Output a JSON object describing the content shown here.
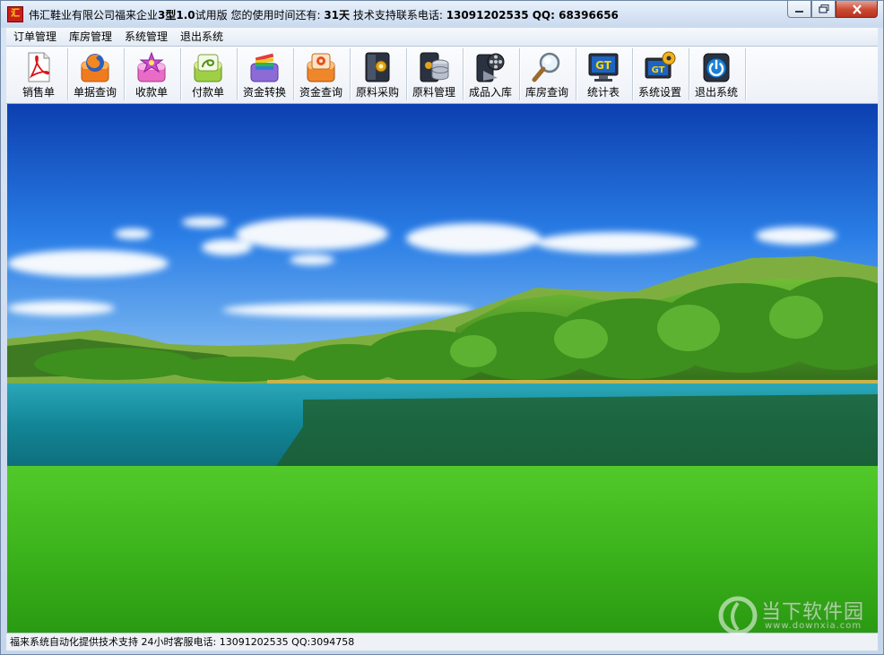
{
  "titlebar": {
    "app_name": "伟汇鞋业有限公司福来企业",
    "edition": "3型1.0",
    "trial": "试用版  您的使用时间还有:",
    "days": "31天",
    "support": "  技术支持联系电话:",
    "phone": "13091202535 QQ: 68396656",
    "icon_glyph": "汇"
  },
  "menu": [
    "订单管理",
    "库房管理",
    "系统管理",
    "退出系统"
  ],
  "toolbar": [
    {
      "label": "销售单",
      "icon": "pdf-document-icon"
    },
    {
      "label": "单据查询",
      "icon": "firefox-box-icon"
    },
    {
      "label": "收款单",
      "icon": "flower-box-icon"
    },
    {
      "label": "付款单",
      "icon": "green-swirl-box-icon"
    },
    {
      "label": "资金转换",
      "icon": "color-stack-box-icon"
    },
    {
      "label": "资金查询",
      "icon": "orange-box-icon"
    },
    {
      "label": "原料采购",
      "icon": "dark-box-icon"
    },
    {
      "label": "原料管理",
      "icon": "database-box-icon"
    },
    {
      "label": "成品入库",
      "icon": "film-reel-box-icon"
    },
    {
      "label": "库房查询",
      "icon": "magnifier-icon"
    },
    {
      "label": "统计表",
      "icon": "monitor-gt-icon"
    },
    {
      "label": "系统设置",
      "icon": "gt-settings-icon"
    },
    {
      "label": "退出系统",
      "icon": "power-icon"
    }
  ],
  "statusbar": {
    "text": "福来系统自动化提供技术支持 24小时客服电话: 13091202535   QQ:3094758"
  },
  "watermark": {
    "text": "当下软件园",
    "sub": "www.downxia.com"
  },
  "colors": {
    "close_button": "#c94a33",
    "sky": "#1f6ed8",
    "grass": "#39b41b",
    "lake": "#1c8ba0"
  }
}
